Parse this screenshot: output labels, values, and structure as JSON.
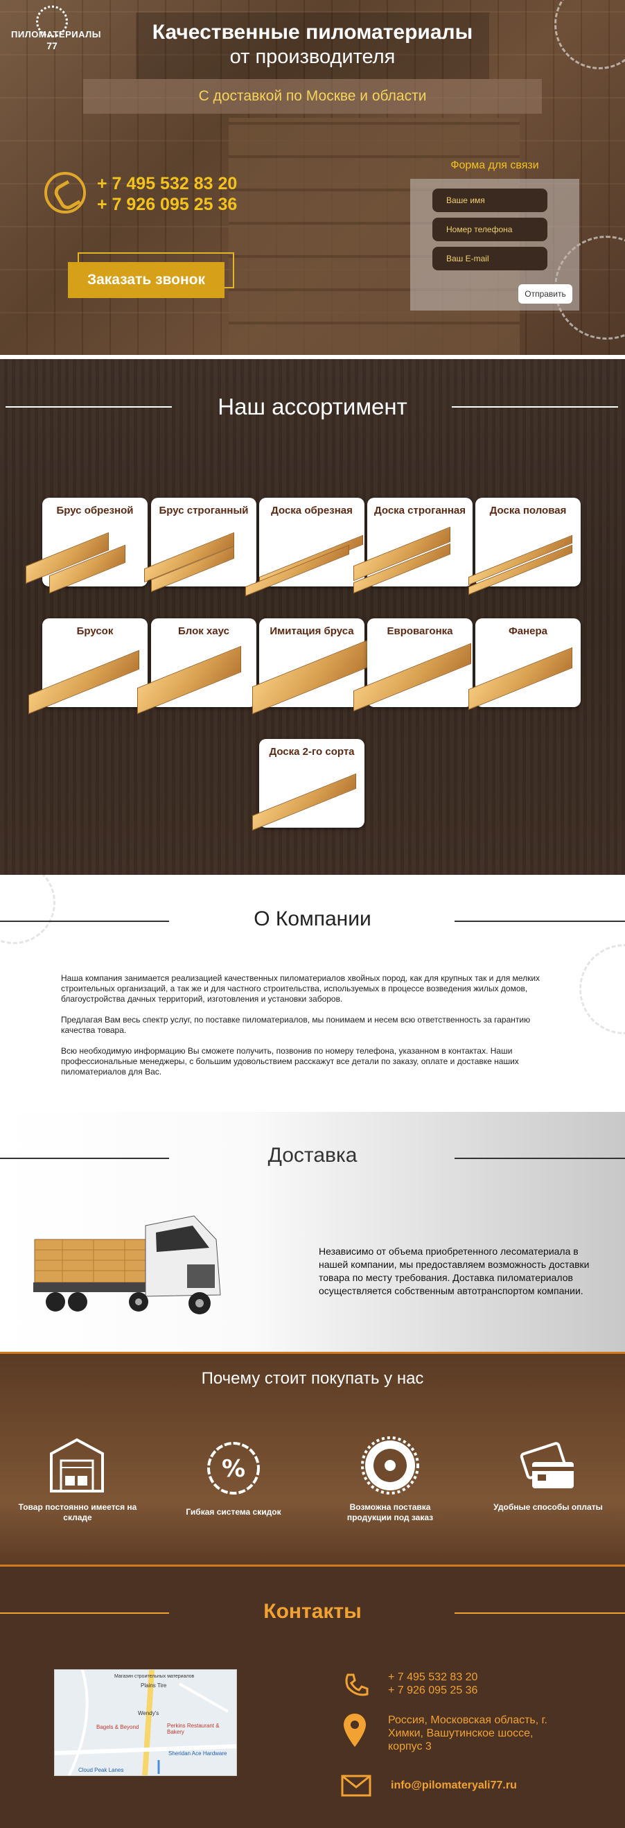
{
  "brand": {
    "logo_line1": "ПИЛОМАТЕРИАЛЫ",
    "logo_line2": "77"
  },
  "hero": {
    "title_line1": "Качественные пиломатериалы",
    "title_line2": "от производителя",
    "subtitle": "С доставкой по Москве и области",
    "phone1": "+ 7 495 532 83 20",
    "phone2": "+ 7 926 095 25 36",
    "call_button": "Заказать звонок"
  },
  "contact_form": {
    "title": "Форма для связи",
    "name_placeholder": "Ваше имя",
    "phone_placeholder": "Номер телефона",
    "email_placeholder": "Ваш E-mail",
    "submit": "Отправить"
  },
  "assortment": {
    "title": "Наш ассортимент",
    "items": [
      "Брус обрезной",
      "Брус строганный",
      "Доска обрезная",
      "Доска строганная",
      "Доска половая",
      "Брусок",
      "Блок хаус",
      "Имитация бруса",
      "Евровагонка",
      "Фанера",
      "Доска 2-го сорта"
    ]
  },
  "about": {
    "title": "О Компании",
    "p1": "Наша компания занимается реализацией качественных пиломатериалов хвойных пород, как для крупных так и для мелких строительных организаций, а так же и для частного строительства, используемых в процессе возведения жилых домов, благоустройства дачных территорий, изготовления и установки заборов.",
    "p2": "Предлагая Вам весь спектр услуг, по поставке пиломатериалов, мы понимаем и несем всю ответственность за гарантию качества товара.",
    "p3": "Всю необходимую информацию Вы сможете получить, позвонив по номеру телефона, указанном в контактах. Наши профессиональные менеджеры, с большим удовольствием расскажут все детали по заказу, оплате и доставке наших пиломатериалов для Вас."
  },
  "delivery": {
    "title": "Доставка",
    "text": "Независимо от объема приобретенного лесоматериала в нашей компании, мы предоставляем возможность доставки товара по месту требования. Доставка пиломатериалов осуществляется собственным автотранспортом компании."
  },
  "why": {
    "title": "Почему стоит покупать у нас",
    "items": [
      {
        "label": "Товар постоянно имеется на складе",
        "icon": "warehouse-icon"
      },
      {
        "label": "Гибкая система скидок",
        "icon": "discount-icon"
      },
      {
        "label": "Возможна поставка продукции под заказ",
        "icon": "saw-blade-icon"
      },
      {
        "label": "Удобные способы оплаты",
        "icon": "credit-card-icon"
      }
    ]
  },
  "contacts": {
    "title": "Контакты",
    "phone1": "+ 7 495 532 83 20",
    "phone2": "+ 7 926 095 25 36",
    "address": "Россия, Московская область, г. Химки, Вашутинское шоссе, корпус 3",
    "email": "info@pilomateryali77.ru",
    "map_labels": [
      "Магазин строительных материалов",
      "Plains Tire",
      "Wendy's",
      "Bagels & Beyond",
      "Perkins Restaurant & Bakery",
      "Sheridan Ace Hardware",
      "Cloud Peak Lanes"
    ]
  },
  "colors": {
    "accent": "#f4c21f",
    "orange": "#f2a233",
    "dark_brown": "#4b3223"
  }
}
